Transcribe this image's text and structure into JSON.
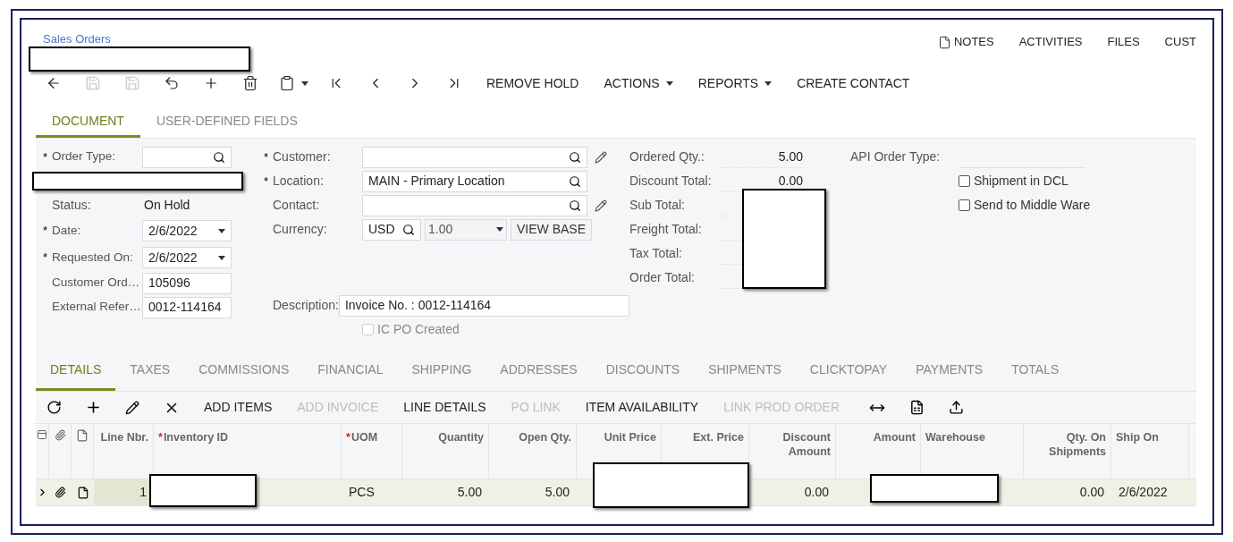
{
  "breadcrumb": "Sales Orders",
  "top_links": [
    {
      "label": "NOTES",
      "has_icon": true
    },
    {
      "label": "ACTIVITIES",
      "has_icon": false
    },
    {
      "label": "FILES",
      "has_icon": false
    },
    {
      "label": "CUST",
      "has_icon": false
    }
  ],
  "toolbar": {
    "icon_buttons": [
      {
        "disabled": false
      },
      {
        "disabled": true
      },
      {
        "disabled": true
      },
      {
        "disabled": false
      },
      {
        "disabled": false
      },
      {
        "disabled": false
      },
      {
        "disabled": false
      },
      {
        "disabled": false
      },
      {
        "disabled": false
      },
      {
        "disabled": false
      },
      {
        "disabled": false
      }
    ],
    "buttons": [
      {
        "label": "REMOVE HOLD",
        "menu": false
      },
      {
        "label": "ACTIONS",
        "menu": true
      },
      {
        "label": "REPORTS",
        "menu": true
      },
      {
        "label": "CREATE CONTACT",
        "menu": false
      }
    ]
  },
  "tabs": [
    {
      "label": "DOCUMENT",
      "selected": true
    },
    {
      "label": "USER-DEFINED FIELDS",
      "selected": false
    }
  ],
  "form": {
    "left": [
      {
        "kind": "lookup",
        "label": "Order Type:",
        "mark": "*"
      },
      {
        "kind": "redacted"
      },
      {
        "kind": "text",
        "label": "Status:",
        "value": "On Hold"
      },
      {
        "kind": "dropdown",
        "label": "Date:",
        "mark": "*",
        "value": "2/6/2022"
      },
      {
        "kind": "dropdown",
        "label": "Requested On:",
        "mark": "*",
        "value": "2/6/2022"
      },
      {
        "kind": "input",
        "label": "Customer Ord…",
        "value": "105096"
      },
      {
        "kind": "input",
        "label": "External Refer…",
        "value": "0012-114164"
      }
    ],
    "middle": [
      {
        "kind": "lookup",
        "label": "Customer:",
        "mark": "*",
        "editable": true
      },
      {
        "kind": "lookup",
        "label": "Location:",
        "mark": "*",
        "editable": false,
        "value": "MAIN - Primary Location"
      },
      {
        "kind": "lookup",
        "label": "Contact:",
        "editable": true
      },
      {
        "kind": "currency",
        "label": "Currency:",
        "value": "USD",
        "rate": "1.00",
        "button": "VIEW BASE"
      },
      {
        "kind": "input",
        "label": "Description:",
        "value": "Invoice No. : 0012-114164"
      },
      {
        "kind": "checkbox",
        "label": "IC PO Created",
        "checked": false,
        "disabled": true
      }
    ],
    "totals": [
      {
        "label": "Ordered Qty.:",
        "value": "5.00"
      },
      {
        "label": "Discount Total:",
        "value": "0.00"
      },
      {
        "label": "Sub Total:"
      },
      {
        "label": "Freight Total:"
      },
      {
        "label": "Tax Total:"
      },
      {
        "label": "Order Total:"
      }
    ],
    "api_order_type": {
      "label": "API Order Type:"
    },
    "flags": [
      {
        "label": "Shipment in DCL",
        "checked": false,
        "disabled": false
      },
      {
        "label": "Send to Middle Ware",
        "checked": false,
        "disabled": false
      }
    ]
  },
  "grid_tabs": [
    {
      "label": "DETAILS",
      "selected": true
    },
    {
      "label": "TAXES",
      "selected": false
    },
    {
      "label": "COMMISSIONS",
      "selected": false
    },
    {
      "label": "FINANCIAL",
      "selected": false
    },
    {
      "label": "SHIPPING",
      "selected": false
    },
    {
      "label": "ADDRESSES",
      "selected": false
    },
    {
      "label": "DISCOUNTS",
      "selected": false
    },
    {
      "label": "SHIPMENTS",
      "selected": false
    },
    {
      "label": "CLICKTOPAY",
      "selected": false
    },
    {
      "label": "PAYMENTS",
      "selected": false
    },
    {
      "label": "TOTALS",
      "selected": false
    }
  ],
  "grid_toolbar": [
    {
      "label": "ADD ITEMS",
      "disabled": false
    },
    {
      "label": "ADD INVOICE",
      "disabled": true
    },
    {
      "label": "LINE DETAILS",
      "disabled": false
    },
    {
      "label": "PO LINK",
      "disabled": true
    },
    {
      "label": "ITEM AVAILABILITY",
      "disabled": false
    },
    {
      "label": "LINK PROD ORDER",
      "disabled": true
    }
  ],
  "grid": {
    "columns": [
      {
        "label": "Line Nbr."
      },
      {
        "label": "Inventory ID",
        "mark": "*"
      },
      {
        "label": "UOM",
        "mark": "*"
      },
      {
        "label": "Quantity"
      },
      {
        "label": "Open Qty."
      },
      {
        "label": "Unit Price"
      },
      {
        "label": "Ext. Price"
      },
      {
        "label": "Discount Amount"
      },
      {
        "label": "Amount"
      },
      {
        "label": "Warehouse"
      },
      {
        "label": "Qty. On Shipments"
      },
      {
        "label": "Ship On"
      }
    ],
    "rows": [
      {
        "selected": true,
        "cells": [
          "1",
          null,
          "PCS",
          "5.00",
          "5.00",
          null,
          null,
          "0.00",
          null,
          null,
          "0.00",
          "2/6/2022"
        ]
      }
    ]
  }
}
